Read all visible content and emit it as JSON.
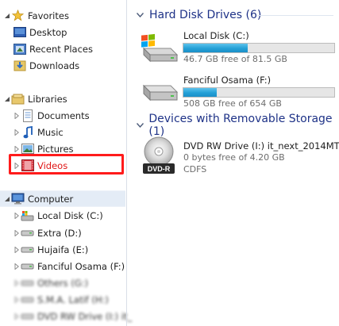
{
  "nav": {
    "favorites": {
      "label": "Favorites",
      "items": [
        {
          "label": "Desktop",
          "icon": "desktop-icon"
        },
        {
          "label": "Recent Places",
          "icon": "recent-places-icon"
        },
        {
          "label": "Downloads",
          "icon": "downloads-folder-icon"
        }
      ]
    },
    "libraries": {
      "label": "Libraries",
      "items": [
        {
          "label": "Documents",
          "icon": "documents-icon"
        },
        {
          "label": "Music",
          "icon": "music-icon"
        },
        {
          "label": "Pictures",
          "icon": "pictures-icon"
        },
        {
          "label": "Videos",
          "icon": "videos-icon",
          "highlighted": true
        }
      ]
    },
    "computer": {
      "label": "Computer",
      "items": [
        {
          "label": "Local Disk (C:)",
          "icon": "system-drive-icon"
        },
        {
          "label": "Extra (D:)",
          "icon": "drive-icon"
        },
        {
          "label": "Hujaifa (E:)",
          "icon": "drive-icon"
        },
        {
          "label": "Fanciful Osama (F:)",
          "icon": "drive-icon"
        },
        {
          "label": "Others (G:)",
          "icon": "drive-icon",
          "blurred": true
        },
        {
          "label": "S.M.A. Latif (H:)",
          "icon": "drive-icon",
          "blurred": true
        },
        {
          "label": "DVD RW Drive (I:) it_",
          "icon": "dvd-drive-icon",
          "blurred": true
        }
      ]
    }
  },
  "content": {
    "hard_disks": {
      "heading": "Hard Disk Drives (6)",
      "drives": [
        {
          "name": "Local Disk (C:)",
          "free_text": "46.7 GB free of 81.5 GB",
          "used_fraction": 0.427,
          "icon": "windows-system-drive-icon"
        },
        {
          "name": "Fanciful Osama (F:)",
          "free_text": "508 GB free of 654 GB",
          "used_fraction": 0.223,
          "icon": "hard-drive-icon"
        }
      ]
    },
    "removable": {
      "heading": "Devices with Removable Storage (1)",
      "devices": [
        {
          "name": "DVD RW Drive (I:) it_next_2014MT",
          "free_text": "0 bytes free of 4.20 GB",
          "filesystem": "CDFS",
          "icon": "dvd-r-disc-icon",
          "icon_text": "DVD-R"
        }
      ]
    }
  },
  "colors": {
    "heading": "#1e3287",
    "highlight_border": "#ff1b1b",
    "bar_fill": "#26a0da",
    "computer_row_bg": "#e4ecf6"
  }
}
